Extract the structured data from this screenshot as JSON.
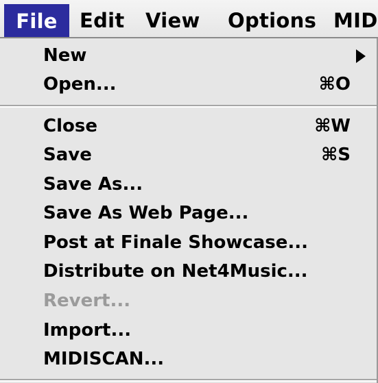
{
  "menubar": {
    "items": [
      {
        "label": "File",
        "active": true
      },
      {
        "label": "Edit"
      },
      {
        "label": "View"
      },
      {
        "label": "Options"
      },
      {
        "label": "MID"
      }
    ]
  },
  "file_menu": {
    "items": [
      {
        "label": "New",
        "has_submenu": true
      },
      {
        "label": "Open...",
        "shortcut": "⌘O"
      },
      {
        "label": "Close",
        "shortcut": "⌘W"
      },
      {
        "label": "Save",
        "shortcut": "⌘S"
      },
      {
        "label": "Save As..."
      },
      {
        "label": "Save As Web Page..."
      },
      {
        "label": "Post at Finale Showcase..."
      },
      {
        "label": "Distribute on Net4Music..."
      },
      {
        "label": "Revert...",
        "disabled": true
      },
      {
        "label": "Import..."
      },
      {
        "label": "MIDISCAN..."
      }
    ]
  },
  "colors": {
    "menubar_bg": "#e6e6e6",
    "active_title_bg": "#2c2c9e",
    "active_title_text": "#ffffff",
    "disabled_text": "#9b9b9b"
  }
}
